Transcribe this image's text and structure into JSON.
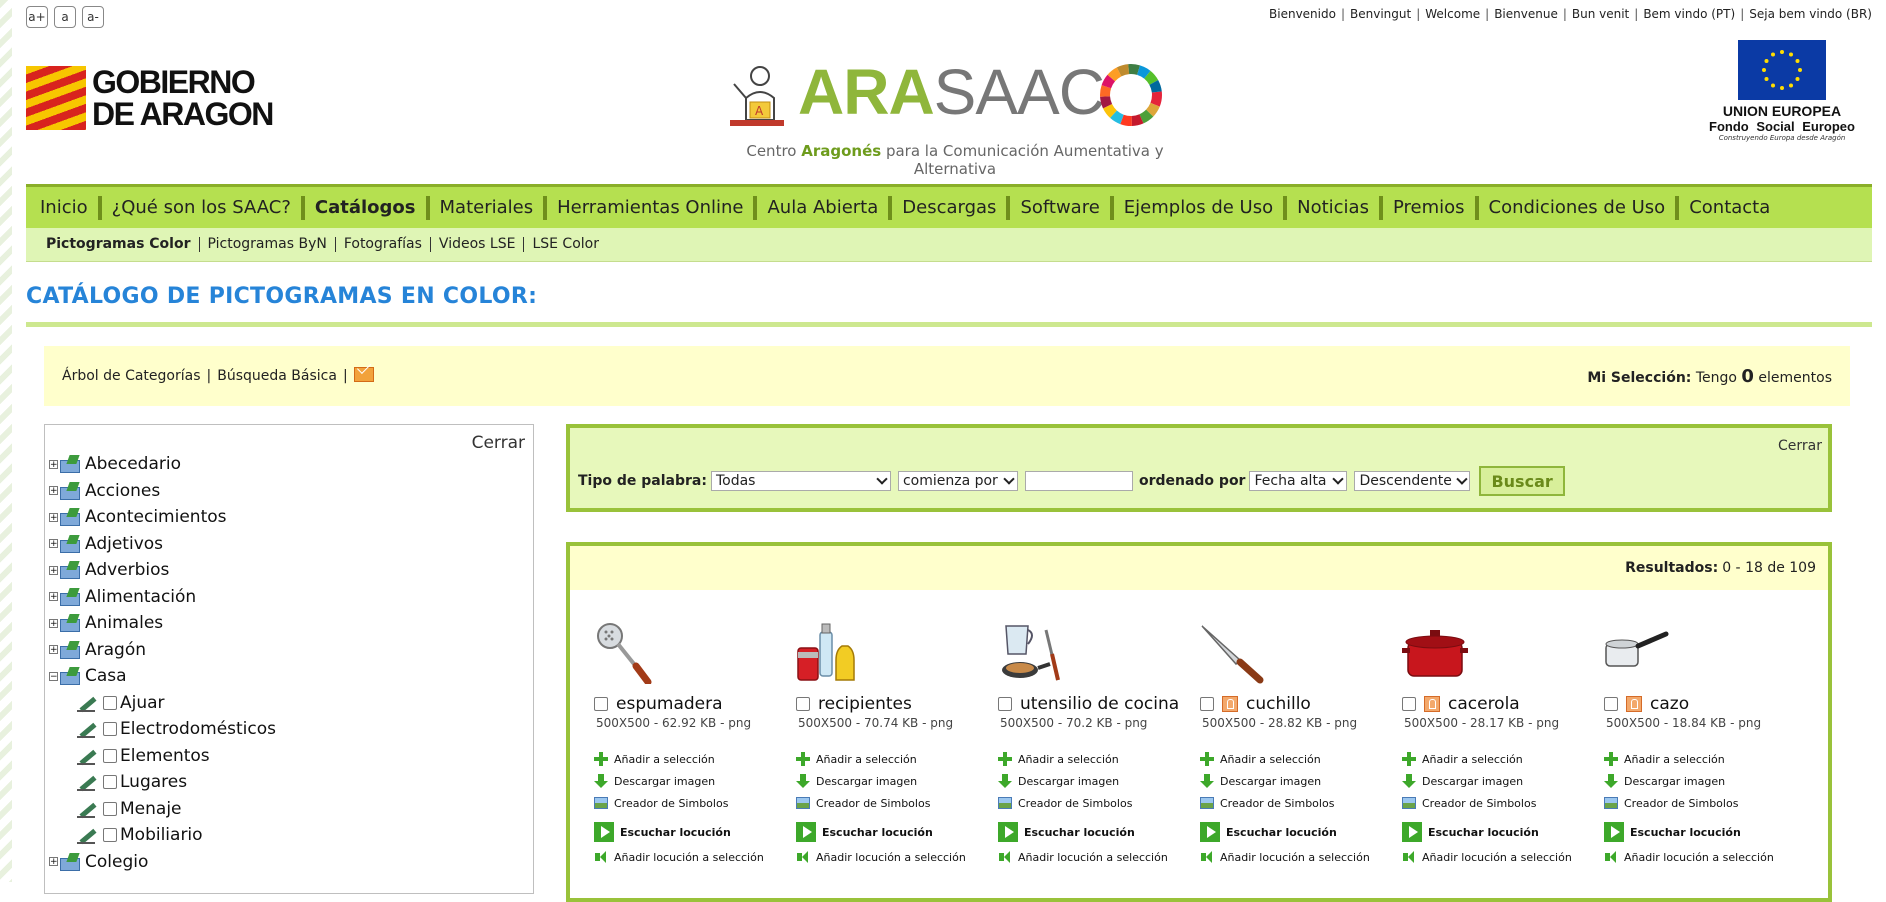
{
  "font_controls": [
    "a+",
    "a",
    "a-"
  ],
  "greetings": [
    "Bienvenido",
    "Benvingut",
    "Welcome",
    "Bienvenue",
    "Bun venit",
    "Bem vindo (PT)",
    "Seja bem vindo (BR)"
  ],
  "header": {
    "gov_line1": "GOBIERNO",
    "gov_line2": "DE ARAGON",
    "arasaac_part1": "ARA",
    "arasaac_part2": "SAAC",
    "tagline_pre": "Centro ",
    "tagline_bold": "Aragonés",
    "tagline_post": " para la Comunicación Aumentativa y Alternativa",
    "eu_title": "UNION EUROPEA",
    "eu_sub": "Fondo Social Europeo",
    "eu_tiny": "Construyendo Europa desde Aragón"
  },
  "nav": [
    "Inicio",
    "¿Qué son los SAAC?",
    "Catálogos",
    "Materiales",
    "Herramientas Online",
    "Aula Abierta",
    "Descargas",
    "Software",
    "Ejemplos de Uso",
    "Noticias",
    "Premios",
    "Condiciones de Uso",
    "Contacta"
  ],
  "subnav": [
    "Pictogramas Color",
    "Pictogramas ByN",
    "Fotografías",
    "Videos LSE",
    "LSE Color"
  ],
  "page_title": "CATÁLOGO DE PICTOGRAMAS EN COLOR:",
  "toolbar": {
    "tree_link": "Árbol de Categorías",
    "search_link": "Búsqueda Básica",
    "selection_label": "Mi Selección:",
    "selection_pre": "Tengo",
    "selection_count": "0",
    "selection_post": "elementos"
  },
  "tree": {
    "close": "Cerrar",
    "items": [
      {
        "label": "Abecedario",
        "expanded": false
      },
      {
        "label": "Acciones",
        "expanded": false
      },
      {
        "label": "Acontecimientos",
        "expanded": false
      },
      {
        "label": "Adjetivos",
        "expanded": false
      },
      {
        "label": "Adverbios",
        "expanded": false
      },
      {
        "label": "Alimentación",
        "expanded": false
      },
      {
        "label": "Animales",
        "expanded": false
      },
      {
        "label": "Aragón",
        "expanded": false
      },
      {
        "label": "Casa",
        "expanded": true
      },
      {
        "label": "Colegio",
        "expanded": false
      }
    ],
    "casa_children": [
      "Ajuar",
      "Electrodomésticos",
      "Elementos",
      "Lugares",
      "Menaje",
      "Mobiliario"
    ]
  },
  "search": {
    "close": "Cerrar",
    "tipo_label": "Tipo de palabra:",
    "tipo_value": "Todas",
    "match_value": "comienza por",
    "text_value": "",
    "order_label": "ordenado por",
    "order_value": "Fecha alta",
    "direction_value": "Descendente",
    "button": "Buscar"
  },
  "results": {
    "label": "Resultados:",
    "range": "0 - 18 de 109",
    "action_add": "Añadir a selección",
    "action_download": "Descargar imagen",
    "action_creator": "Creador de Simbolos",
    "action_listen": "Escuchar locución",
    "action_add_audio": "Añadir locución a selección",
    "items": [
      {
        "name": "espumadera",
        "meta": "500X500 - 62.92 KB - png",
        "icon": "skimmer-icon",
        "sign": false
      },
      {
        "name": "recipientes",
        "meta": "500X500 - 70.74 KB - png",
        "icon": "containers-icon",
        "sign": false
      },
      {
        "name": "utensilio de cocina",
        "meta": "500X500 - 70.2 KB - png",
        "icon": "kitchen-utensil-icon",
        "sign": false
      },
      {
        "name": "cuchillo",
        "meta": "500X500 - 28.82 KB - png",
        "icon": "knife-icon",
        "sign": true
      },
      {
        "name": "cacerola",
        "meta": "500X500 - 28.17 KB - png",
        "icon": "pot-icon",
        "sign": true
      },
      {
        "name": "cazo",
        "meta": "500X500 - 18.84 KB - png",
        "icon": "saucepan-icon",
        "sign": true
      }
    ]
  },
  "colors": {
    "nav_green": "#b5e050",
    "subnav_green": "#dff5b5",
    "title_blue": "#2684d8",
    "panel_yellow": "#ffffcc",
    "border_green": "#99c23a"
  }
}
